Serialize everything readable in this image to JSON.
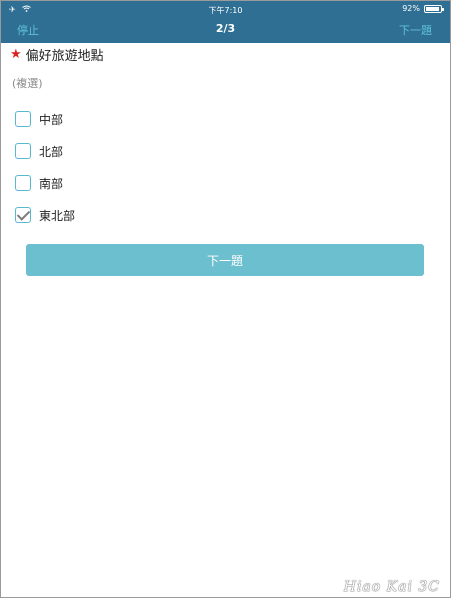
{
  "status_bar": {
    "time": "下午7:10",
    "battery": "92%",
    "airplane_icon": "airplane-icon",
    "wifi_icon": "wifi-icon",
    "battery_level": 0.92
  },
  "nav": {
    "left_label": "停止",
    "title": "2/3",
    "right_label": "下一題"
  },
  "question": {
    "required_marker": "★",
    "title": "偏好旅遊地點",
    "hint": "(複選)"
  },
  "options": [
    {
      "label": "中部",
      "checked": false
    },
    {
      "label": "北部",
      "checked": false
    },
    {
      "label": "南部",
      "checked": false
    },
    {
      "label": "東北部",
      "checked": true
    }
  ],
  "next_button": {
    "label": "下一題"
  },
  "watermark": "Hiao Kai 3C",
  "colors": {
    "topbar": "#2f6f93",
    "accent": "#5fc0da",
    "button": "#6cbfcf",
    "required": "#d92323"
  }
}
